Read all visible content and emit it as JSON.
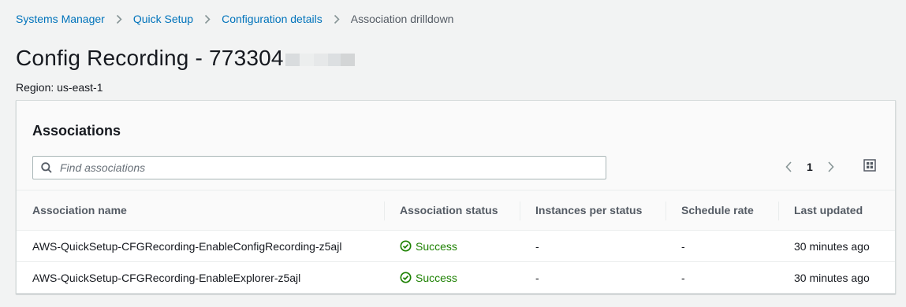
{
  "breadcrumb": {
    "items": [
      "Systems Manager",
      "Quick Setup",
      "Configuration details"
    ],
    "current": "Association drilldown"
  },
  "page": {
    "title": "Config Recording - 773304",
    "region": "Region: us-east-1"
  },
  "panel": {
    "title": "Associations",
    "search_placeholder": "Find associations",
    "page_number": "1"
  },
  "table": {
    "columns": [
      "Association name",
      "Association status",
      "Instances per status",
      "Schedule rate",
      "Last updated"
    ],
    "rows": [
      {
        "name": "AWS-QuickSetup-CFGRecording-EnableConfigRecording-z5ajl",
        "status": "Success",
        "instances": "-",
        "schedule": "-",
        "updated": "30 minutes ago"
      },
      {
        "name": "AWS-QuickSetup-CFGRecording-EnableExplorer-z5ajl",
        "status": "Success",
        "instances": "-",
        "schedule": "-",
        "updated": "30 minutes ago"
      }
    ]
  },
  "icons": {
    "search": "search-icon",
    "success": "check-circle-icon",
    "prev": "chevron-left-icon",
    "next": "chevron-right-icon",
    "settings": "settings-grid-icon",
    "breadcrumb_sep": "chevron-right-icon"
  },
  "colors": {
    "link": "#0073bb",
    "success": "#1d8102",
    "background": "#f2f3f3"
  }
}
